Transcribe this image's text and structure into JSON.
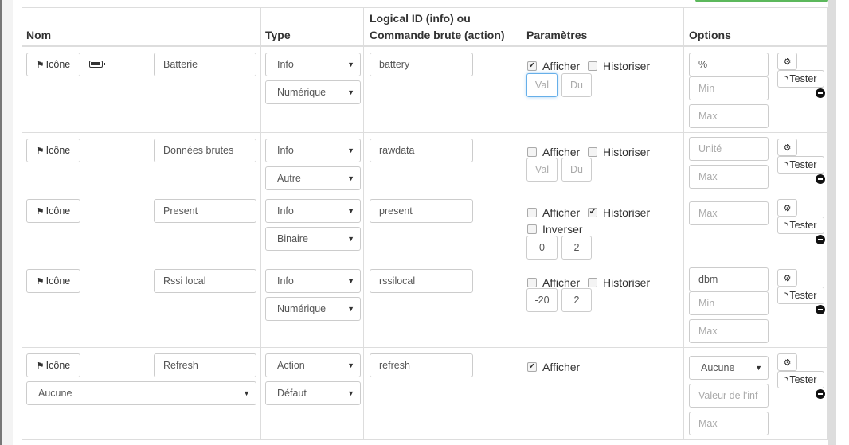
{
  "header": {
    "nom": "Nom",
    "type": "Type",
    "logical_id_line1": "Logical ID (info) ou",
    "logical_id_line2": "Commande brute (action)",
    "parametres": "Paramètres",
    "options": "Options"
  },
  "labels": {
    "icon_button": "Icône",
    "afficher": "Afficher",
    "historiser": "Historiser",
    "inverser": "Inverser",
    "tester": "Tester"
  },
  "icons": {
    "icon_button": "flag-icon",
    "configure": "gears-icon",
    "tester": "rss-icon",
    "remove": "minus-circle-icon",
    "battery": "battery-full-icon"
  },
  "rows": [
    {
      "name": "Batterie",
      "type": "Info",
      "subtype": "Numérique",
      "logical_id": "battery",
      "afficher": true,
      "historiser": false,
      "params": [
        {
          "value": "",
          "placeholder": "Val"
        },
        {
          "value": "",
          "placeholder": "Du"
        }
      ],
      "options": [
        {
          "value": "%",
          "placeholder": ""
        },
        {
          "value": "",
          "placeholder": "Min"
        },
        {
          "value": "",
          "placeholder": "Max"
        }
      ]
    },
    {
      "name": "Données brutes",
      "type": "Info",
      "subtype": "Autre",
      "logical_id": "rawdata",
      "afficher": false,
      "historiser": false,
      "params": [
        {
          "value": "",
          "placeholder": "Val"
        },
        {
          "value": "",
          "placeholder": "Du"
        }
      ],
      "options": [
        {
          "value": "",
          "placeholder": "Unité"
        },
        {
          "value": "",
          "placeholder": "Max"
        }
      ]
    },
    {
      "name": "Present",
      "type": "Info",
      "subtype": "Binaire",
      "logical_id": "present",
      "afficher": false,
      "historiser": true,
      "inverser": false,
      "params": [
        {
          "value": "0",
          "placeholder": ""
        },
        {
          "value": "2",
          "placeholder": ""
        }
      ],
      "options": [
        {
          "value": "",
          "placeholder": "Max"
        }
      ]
    },
    {
      "name": "Rssi local",
      "type": "Info",
      "subtype": "Numérique",
      "logical_id": "rssilocal",
      "afficher": false,
      "historiser": false,
      "params": [
        {
          "value": "-20",
          "placeholder": ""
        },
        {
          "value": "2",
          "placeholder": ""
        }
      ],
      "options": [
        {
          "value": "dbm",
          "placeholder": ""
        },
        {
          "value": "",
          "placeholder": "Min"
        },
        {
          "value": "",
          "placeholder": "Max"
        }
      ]
    },
    {
      "name": "Refresh",
      "type": "Action",
      "subtype": "Défaut",
      "logical_id": "refresh",
      "afficher": true,
      "value_select": "Aucune",
      "options_select": "Aucune",
      "options": [
        {
          "value": "",
          "placeholder": "Valeur de l'inf"
        },
        {
          "value": "",
          "placeholder": "Max"
        }
      ]
    }
  ]
}
